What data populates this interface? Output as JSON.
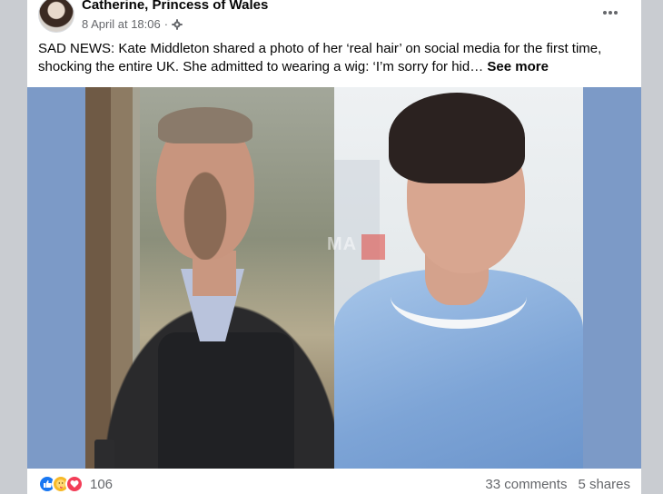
{
  "post": {
    "author_name": "Catherine, Princess of Wales",
    "date": "8 April at 18:06",
    "separator": "·",
    "audience_icon": "gear-icon",
    "more_icon": "ellipsis-icon",
    "text": "SAD NEWS: Kate Middleton shared a photo of her ‘real hair’ on social media for the first time, shocking the entire UK. She admitted to wearing a wig: ‘I’m sorry for hid…",
    "see_more": "See more",
    "watermark": "MA"
  },
  "footer": {
    "reaction_icons": [
      "like-icon",
      "care-icon",
      "love-icon"
    ],
    "reaction_count": "106",
    "comments": "33 comments",
    "shares": "5 shares"
  },
  "colors": {
    "like": "#1877f2",
    "care": "#f7b928",
    "love": "#f33e58",
    "media_background": "#7c9ac7"
  }
}
